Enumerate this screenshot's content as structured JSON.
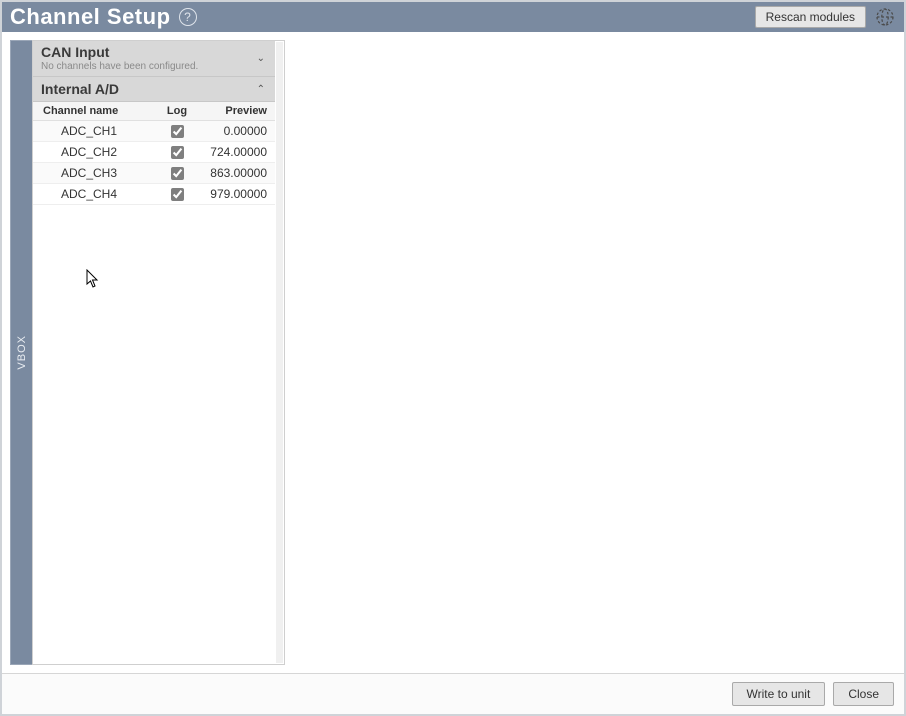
{
  "header": {
    "title": "Channel Setup",
    "rescan_label": "Rescan modules"
  },
  "sidebar_tab": "VBOX",
  "sections": {
    "can_input": {
      "title": "CAN Input",
      "subtitle": "No channels have been configured."
    },
    "internal_ad": {
      "title": "Internal A/D",
      "columns": {
        "name": "Channel name",
        "log": "Log",
        "preview": "Preview"
      },
      "rows": [
        {
          "name": "ADC_CH1",
          "log": true,
          "preview": "0.00000"
        },
        {
          "name": "ADC_CH2",
          "log": true,
          "preview": "724.00000"
        },
        {
          "name": "ADC_CH3",
          "log": true,
          "preview": "863.00000"
        },
        {
          "name": "ADC_CH4",
          "log": true,
          "preview": "979.00000"
        }
      ]
    }
  },
  "footer": {
    "write_label": "Write to unit",
    "close_label": "Close"
  }
}
